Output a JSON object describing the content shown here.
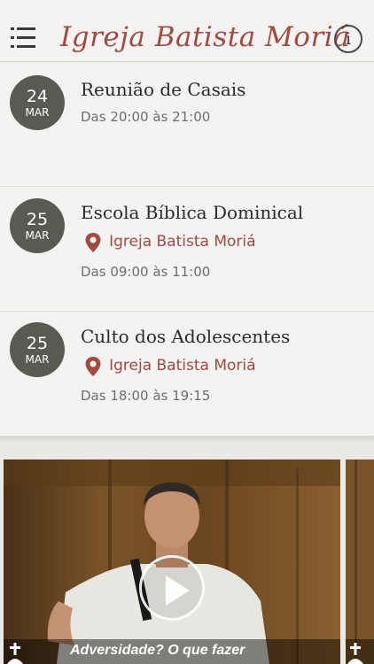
{
  "header": {
    "title": "Igreja Batista Moriá",
    "info_label": "i"
  },
  "events": [
    {
      "day": "24",
      "month": "MAR",
      "title": "Reunião de Casais",
      "location": "",
      "time": "Das 20:00 às 21:00"
    },
    {
      "day": "25",
      "month": "MAR",
      "title": "Escola Bíblica Dominical",
      "location": "Igreja Batista Moriá",
      "time": "Das 09:00 às 11:00"
    },
    {
      "day": "25",
      "month": "MAR",
      "title": "Culto dos Adolescentes",
      "location": "Igreja Batista Moriá",
      "time": "Das 18:00 às 19:15"
    }
  ],
  "videos": [
    {
      "caption": "Adversidade? O que fazer"
    }
  ],
  "colors": {
    "accent": "#a04a42",
    "badge": "#5a5a52",
    "background": "#ebe9e5",
    "card": "#f4f3f1"
  },
  "icons": {
    "menu": "menu-icon",
    "info": "info-icon",
    "location": "location-pin-icon",
    "play": "play-icon"
  }
}
